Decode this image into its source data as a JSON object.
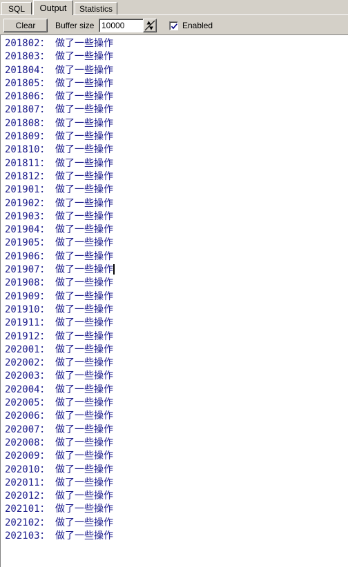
{
  "tabs": [
    {
      "label": "SQL",
      "active": false
    },
    {
      "label": "Output",
      "active": true
    },
    {
      "label": "Statistics",
      "active": false
    }
  ],
  "toolbar": {
    "clear_label": "Clear",
    "buffer_size_label": "Buffer size",
    "buffer_size_value": "10000",
    "buffer_size_placeholder": "10000",
    "enabled_label": "Enabled",
    "enabled_checked": true,
    "spinner_up_icon": "spinner-up-arrow",
    "spinner_down_icon": "spinner-down-arrow",
    "checkbox_check_icon": "check-mark"
  },
  "output": {
    "text_color": "#1a1a8c",
    "background_color": "#ffffff",
    "caret_line_index": 5,
    "message_suffix": "： 做了一些操作",
    "lines": [
      "201802： 做了一些操作",
      "201803： 做了一些操作",
      "201804： 做了一些操作",
      "201805： 做了一些操作",
      "201806： 做了一些操作",
      "201807： 做了一些操作",
      "201808： 做了一些操作",
      "201809： 做了一些操作",
      "201810： 做了一些操作",
      "201811： 做了一些操作",
      "201812： 做了一些操作",
      "201901： 做了一些操作",
      "201902： 做了一些操作",
      "201903： 做了一些操作",
      "201904： 做了一些操作",
      "201905： 做了一些操作",
      "201906： 做了一些操作",
      "201907： 做了一些操作",
      "201908： 做了一些操作",
      "201909： 做了一些操作",
      "201910： 做了一些操作",
      "201911： 做了一些操作",
      "201912： 做了一些操作",
      "202001： 做了一些操作",
      "202002： 做了一些操作",
      "202003： 做了一些操作",
      "202004： 做了一些操作",
      "202005： 做了一些操作",
      "202006： 做了一些操作",
      "202007： 做了一些操作",
      "202008： 做了一些操作",
      "202009： 做了一些操作",
      "202010： 做了一些操作",
      "202011： 做了一些操作",
      "202012： 做了一些操作",
      "202101： 做了一些操作",
      "202102： 做了一些操作",
      "202103： 做了一些操作"
    ]
  },
  "colors": {
    "window_face": "#d4d0c8",
    "text_blue": "#1a1a8c",
    "border_dark": "#404040",
    "border_light": "#ffffff"
  }
}
